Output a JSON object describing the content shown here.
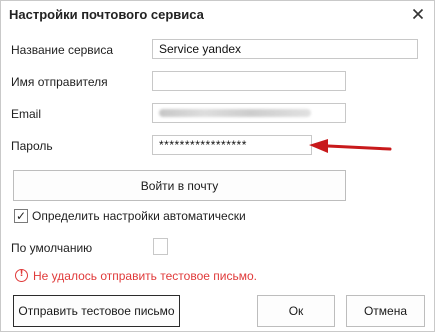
{
  "dialog": {
    "title": "Настройки почтового сервиса",
    "close_icon": "close-icon"
  },
  "form": {
    "service_name": {
      "label": "Название сервиса",
      "value": "Service yandex"
    },
    "sender_name": {
      "label": "Имя отправителя",
      "value": ""
    },
    "email": {
      "label": "Email",
      "value": ""
    },
    "password": {
      "label": "Пароль",
      "value": "*****************"
    }
  },
  "login_button": {
    "label": "Войти в почту"
  },
  "auto_settings": {
    "label": "Определить настройки автоматически",
    "checked": true
  },
  "default": {
    "label": "По умолчанию",
    "checked": false
  },
  "error": {
    "icon": "error-icon",
    "text": "Не удалось отправить тестовое письмо.",
    "color": "#e03a3a"
  },
  "buttons": {
    "send_test": "Отправить тестовое письмо",
    "ok": "Ок",
    "cancel": "Отмена"
  },
  "annotation": {
    "arrow_color": "#c8191b"
  }
}
